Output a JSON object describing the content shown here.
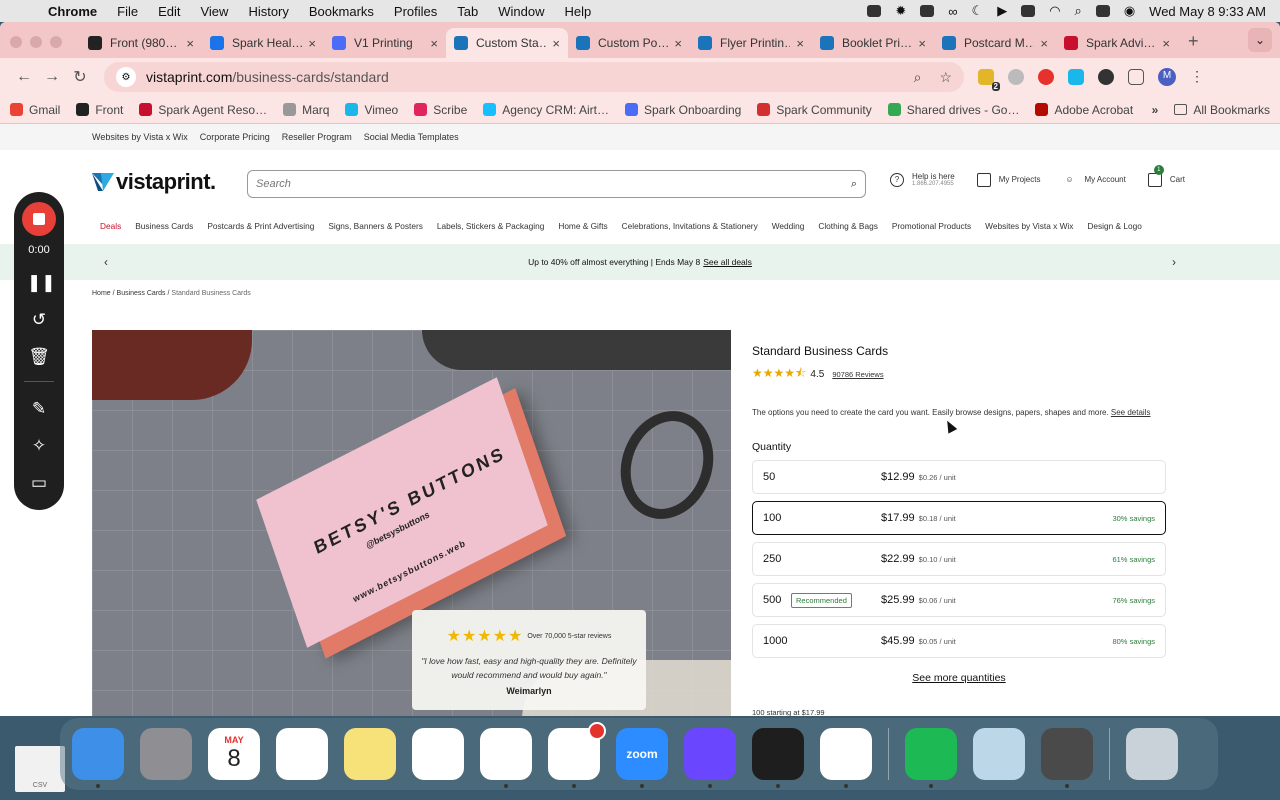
{
  "menubar": {
    "app": "Chrome",
    "items": [
      "File",
      "Edit",
      "View",
      "History",
      "Bookmarks",
      "Profiles",
      "Tab",
      "Window",
      "Help"
    ],
    "datetime": "Wed May 8  9:33 AM"
  },
  "tabs": [
    {
      "title": "Front (980…",
      "favicon_color": "#222222"
    },
    {
      "title": "Spark Heal…",
      "favicon_color": "#1a73e8"
    },
    {
      "title": "V1 Printing",
      "favicon_color": "#4a6cf7"
    },
    {
      "title": "Custom Sta…",
      "favicon_color": "#1b73ba",
      "active": true
    },
    {
      "title": "Custom Po…",
      "favicon_color": "#1b73ba"
    },
    {
      "title": "Flyer Printin…",
      "favicon_color": "#1b73ba"
    },
    {
      "title": "Booklet Pri…",
      "favicon_color": "#1b73ba"
    },
    {
      "title": "Postcard M…",
      "favicon_color": "#1b73ba"
    },
    {
      "title": "Spark Advi…",
      "favicon_color": "#c8102e"
    }
  ],
  "address": {
    "domain": "vistaprint.com",
    "path": "/business-cards/standard"
  },
  "extensions": {
    "badge": "2",
    "avatar": "M"
  },
  "bookmarks": [
    {
      "label": "Gmail",
      "color": "#ea4335"
    },
    {
      "label": "Front",
      "color": "#222222"
    },
    {
      "label": "Spark Agent Reso…",
      "color": "#c8102e"
    },
    {
      "label": "Marq",
      "color": "#999999"
    },
    {
      "label": "Vimeo",
      "color": "#1ab7ea"
    },
    {
      "label": "Scribe",
      "color": "#e0245e"
    },
    {
      "label": "Agency CRM: Airt…",
      "color": "#18bfff"
    },
    {
      "label": "Spark Onboarding",
      "color": "#4a6cf7"
    },
    {
      "label": "Spark Community",
      "color": "#d32f2f"
    },
    {
      "label": "Shared drives - Go…",
      "color": "#34a853"
    },
    {
      "label": "Adobe Acrobat",
      "color": "#b30b00"
    }
  ],
  "bookmarks_more": "»",
  "all_bookmarks": "All Bookmarks",
  "site": {
    "utility_links": [
      "Websites by Vista x Wix",
      "Corporate Pricing",
      "Reseller Program",
      "Social Media Templates"
    ],
    "logo": "vistaprint.",
    "search_placeholder": "Search",
    "help": {
      "label": "Help is here",
      "phone": "1.866.207.4955"
    },
    "my_projects": "My Projects",
    "my_account": "My Account",
    "cart": {
      "label": "Cart",
      "count": "1"
    },
    "categories": [
      "Deals",
      "Business Cards",
      "Postcards & Print Advertising",
      "Signs, Banners & Posters",
      "Labels, Stickers & Packaging",
      "Home & Gifts",
      "Celebrations, Invitations & Stationery",
      "Wedding",
      "Clothing & Bags",
      "Promotional Products",
      "Websites by Vista x Wix",
      "Design & Logo"
    ],
    "promo": {
      "text": "Up to 40% off almost everything | Ends May 8",
      "link": "See all deals"
    },
    "breadcrumbs": [
      "Home",
      "Business Cards",
      "Standard Business Cards"
    ]
  },
  "hero": {
    "card_name": "BETSY'S BUTTONS",
    "card_handle": "@betsysbuttons",
    "card_web": "www.betsysbuttons.web",
    "review": {
      "stars": 5,
      "count_text": "Over 70,000 5-star reviews",
      "quote": "\"I love how fast, easy and high-quality they are. Definitely would recommend and would buy again.\"",
      "author": "Weimarlyn"
    }
  },
  "product": {
    "title": "Standard Business Cards",
    "rating": "4.5",
    "reviews": "90786 Reviews",
    "description": "The options you need to create the card you want. Easily browse designs, papers, shapes and more.",
    "see_details": "See details",
    "quantity_label": "Quantity",
    "quantities": [
      {
        "qty": "50",
        "price": "$12.99",
        "unit": "$0.26 / unit",
        "savings": "",
        "badge": ""
      },
      {
        "qty": "100",
        "price": "$17.99",
        "unit": "$0.18 / unit",
        "savings": "30% savings",
        "badge": "",
        "selected": true
      },
      {
        "qty": "250",
        "price": "$22.99",
        "unit": "$0.10 / unit",
        "savings": "61% savings",
        "badge": ""
      },
      {
        "qty": "500",
        "price": "$25.99",
        "unit": "$0.06 / unit",
        "savings": "76% savings",
        "badge": "Recommended"
      },
      {
        "qty": "1000",
        "price": "$45.99",
        "unit": "$0.05 / unit",
        "savings": "80% savings",
        "badge": ""
      }
    ],
    "see_more": "See more quantities",
    "starting": "100 starting at $17.99"
  },
  "recorder": {
    "time": "0:00"
  },
  "desktop_file": "CSV",
  "dock": [
    {
      "name": "finder",
      "bg": "#3d8fe8"
    },
    {
      "name": "launchpad",
      "bg": "#8e8e93"
    },
    {
      "name": "calendar",
      "bg": "#ffffff",
      "month": "MAY",
      "day": "8"
    },
    {
      "name": "reminders",
      "bg": "#ffffff"
    },
    {
      "name": "notes",
      "bg": "#f7e27a"
    },
    {
      "name": "news",
      "bg": "#ffffff"
    },
    {
      "name": "chrome",
      "bg": "#ffffff"
    },
    {
      "name": "slack",
      "bg": "#ffffff"
    },
    {
      "name": "zoom",
      "bg": "#2d8cff",
      "label": "zoom"
    },
    {
      "name": "loom",
      "bg": "#6b46ff"
    },
    {
      "name": "figma",
      "bg": "#1e1e1e"
    },
    {
      "name": "perplexity",
      "bg": "#ffffff"
    },
    {
      "name": "spotify",
      "bg": "#1db954"
    },
    {
      "name": "preview",
      "bg": "#bcd7e8"
    },
    {
      "name": "calculator",
      "bg": "#4a4a4a"
    },
    {
      "name": "trash",
      "bg": "#c9d2d8"
    }
  ]
}
